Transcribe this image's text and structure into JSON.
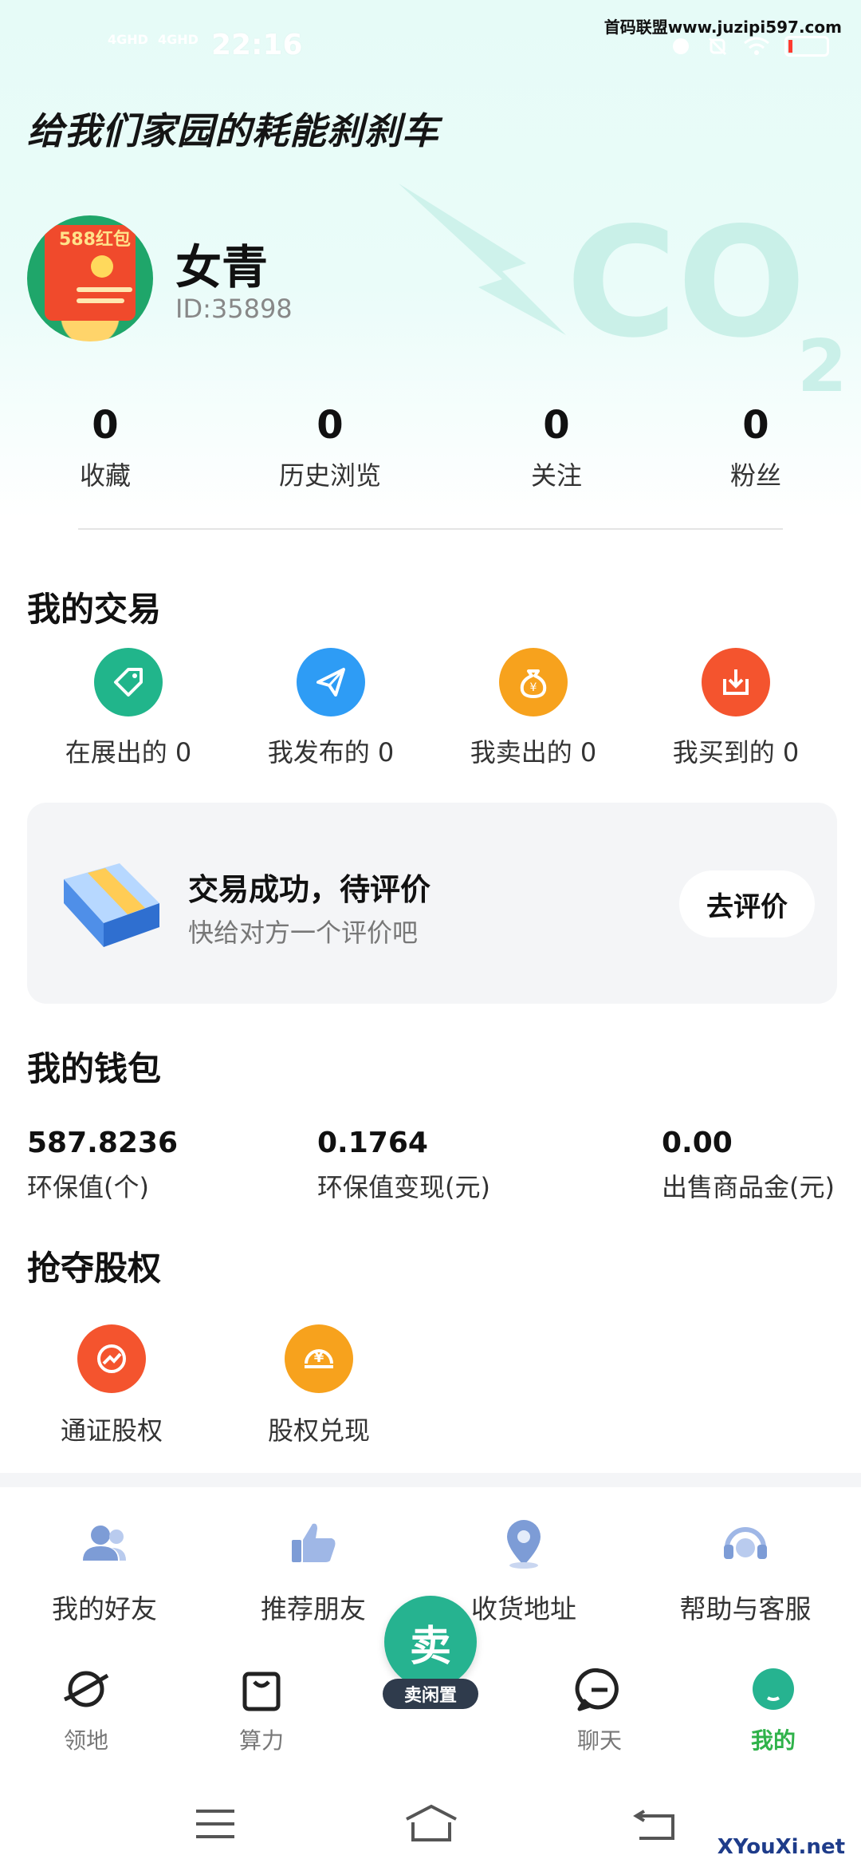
{
  "status_bar": {
    "time": "22:16",
    "signal_1": "4GHD",
    "signal_2": "4GHD",
    "watermark": "首码联盟www.juzipi597.com"
  },
  "header": {
    "slogan": "给我们家园的耗能刹刹车",
    "co2_text": "CO",
    "co2_sub": "2"
  },
  "profile": {
    "avatar_badge": "588红包",
    "name": "女青",
    "id_label": "ID:35898"
  },
  "stats": [
    {
      "value": "0",
      "label": "收藏"
    },
    {
      "value": "0",
      "label": "历史浏览"
    },
    {
      "value": "0",
      "label": "关注"
    },
    {
      "value": "0",
      "label": "粉丝"
    }
  ],
  "my_trade": {
    "title": "我的交易",
    "items": [
      {
        "label": "在展出的 0",
        "icon": "tag-icon",
        "color": "#21b58b"
      },
      {
        "label": "我发布的 0",
        "icon": "paper-plane-icon",
        "color": "#2e9cf5"
      },
      {
        "label": "我卖出的 0",
        "icon": "money-bag-icon",
        "color": "#f7a21d"
      },
      {
        "label": "我买到的 0",
        "icon": "download-box-icon",
        "color": "#f4542e"
      }
    ]
  },
  "review": {
    "title": "交易成功，待评价",
    "subtitle": "快给对方一个评价吧",
    "button": "去评价"
  },
  "wallet": {
    "title": "我的钱包",
    "items": [
      {
        "value": "587.8236",
        "label": "环保值(个)"
      },
      {
        "value": "0.1764",
        "label": "环保值变现(元)"
      },
      {
        "value": "0.00",
        "label": "出售商品金(元)"
      }
    ]
  },
  "equity": {
    "title": "抢夺股权",
    "items": [
      {
        "label": "通证股权",
        "icon": "trend-up-icon",
        "color": "#f4542e"
      },
      {
        "label": "股权兑现",
        "icon": "yen-coin-icon",
        "color": "#f7a21d"
      }
    ]
  },
  "utilities": [
    {
      "label": "我的好友",
      "icon": "friends-icon"
    },
    {
      "label": "推荐朋友",
      "icon": "thumbs-up-icon"
    },
    {
      "label": "收货地址",
      "icon": "location-pin-icon"
    },
    {
      "label": "帮助与客服",
      "icon": "headset-icon"
    }
  ],
  "tabbar": {
    "tabs": [
      {
        "label": "领地",
        "icon": "planet-icon"
      },
      {
        "label": "算力",
        "icon": "shopping-bag-icon"
      },
      {
        "label": "聊天",
        "icon": "chat-bubble-icon"
      },
      {
        "label": "我的",
        "icon": "profile-icon"
      }
    ],
    "sell_button": "卖",
    "sell_tag": "卖闲置",
    "active_color": "#2fb24a"
  },
  "bottom_watermark": "XYouXi.net"
}
